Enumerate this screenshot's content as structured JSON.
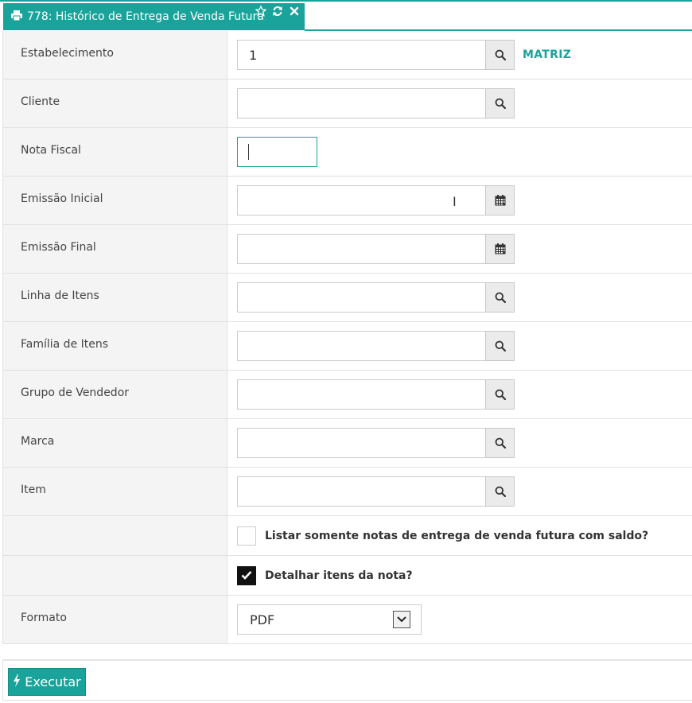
{
  "tab": {
    "title": "778: Histórico de Entrega de Venda Futura",
    "icons": [
      "printer-icon",
      "star-icon",
      "refresh-icon",
      "close-icon"
    ]
  },
  "fields": {
    "estabelecimento": {
      "label": "Estabelecimento",
      "value": "1",
      "hint": "MATRIZ"
    },
    "cliente": {
      "label": "Cliente",
      "value": ""
    },
    "nota_fiscal": {
      "label": "Nota Fiscal",
      "value": ""
    },
    "emissao_inicial": {
      "label": "Emissão Inicial",
      "value": ""
    },
    "emissao_final": {
      "label": "Emissão Final",
      "value": ""
    },
    "linha_itens": {
      "label": "Linha de Itens",
      "value": ""
    },
    "familia_itens": {
      "label": "Família de Itens",
      "value": ""
    },
    "grupo_vendedor": {
      "label": "Grupo de Vendedor",
      "value": ""
    },
    "marca": {
      "label": "Marca",
      "value": ""
    },
    "item": {
      "label": "Item",
      "value": ""
    }
  },
  "checkboxes": {
    "somente_saldo": {
      "label": "Listar somente notas de entrega de venda futura com saldo?",
      "checked": false
    },
    "detalhar_itens": {
      "label": "Detalhar itens da nota?",
      "checked": true
    }
  },
  "formato": {
    "label": "Formato",
    "selected": "PDF"
  },
  "actions": {
    "executar": "Executar"
  },
  "colors": {
    "accent": "#1aa39a",
    "label_bg": "#f4f4f4"
  }
}
